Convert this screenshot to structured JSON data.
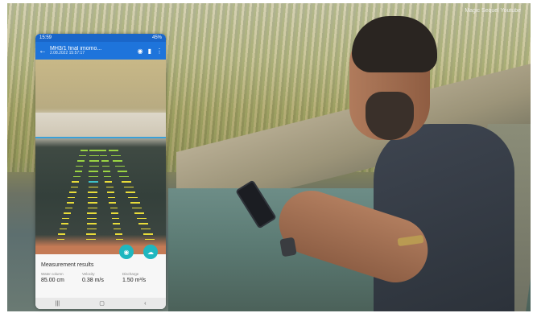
{
  "watermark": "Magic Sequel Youtube",
  "phone": {
    "status": {
      "time": "15:59",
      "right": "45%"
    },
    "appbar": {
      "title": "MH3/1 final imomo...",
      "subtitle": "2.08.2022 15:57:17"
    },
    "results": {
      "heading": "Measurement results",
      "metrics": [
        {
          "label": "Water column",
          "value": "85.00 cm"
        },
        {
          "label": "Velocity",
          "value": "0.38 m/s"
        },
        {
          "label": "Discharge",
          "value": "1.50 m³/s"
        }
      ]
    },
    "nav": {
      "recent": "|||",
      "home": "▢",
      "back": "‹"
    }
  },
  "colors": {
    "appbar": "#1e74db",
    "fab": "#1fb7bf",
    "vector_yellow": "#e8dc3a",
    "vector_green": "#9ad443"
  }
}
